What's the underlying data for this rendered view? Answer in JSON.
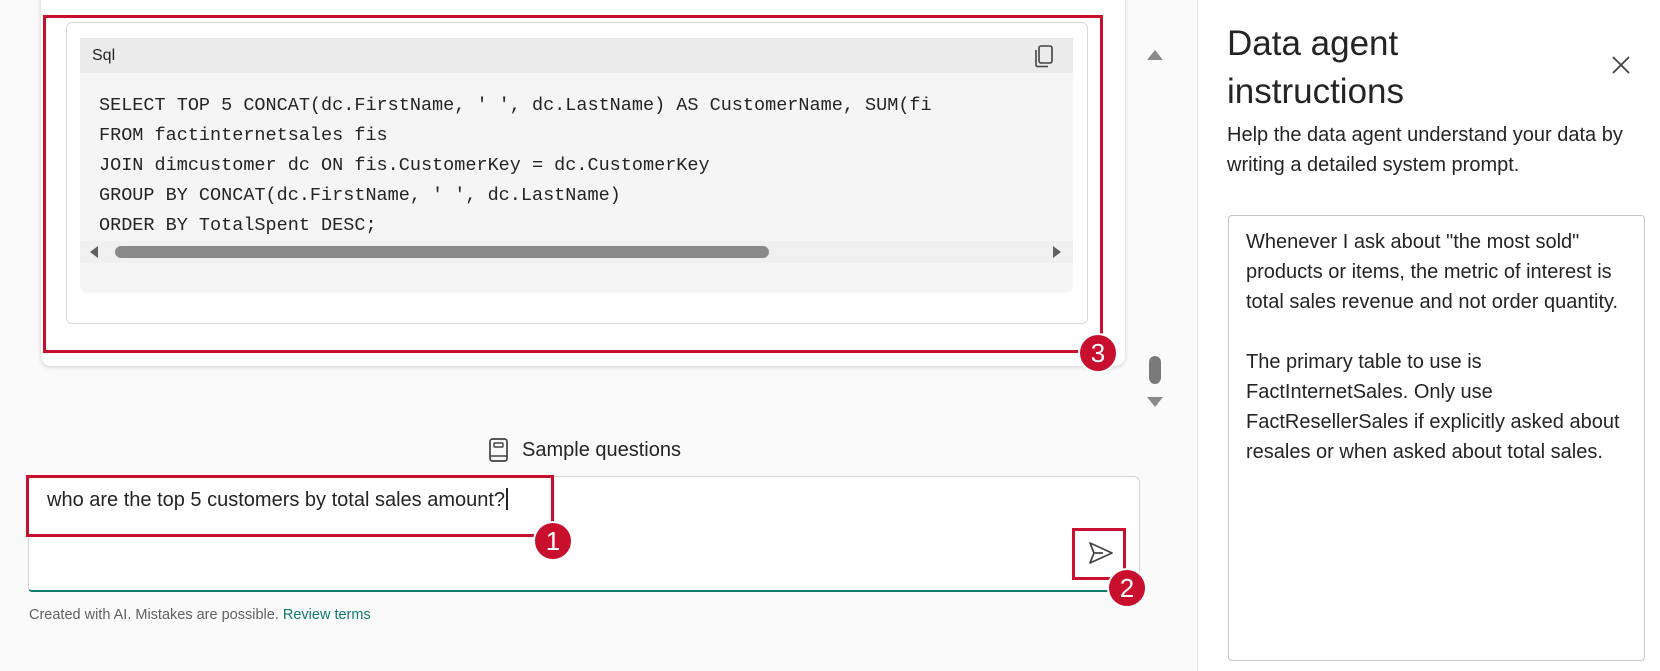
{
  "chat": {
    "code_block": {
      "language": "Sql",
      "lines": [
        "SELECT TOP 5 CONCAT(dc.FirstName, ' ', dc.LastName) AS CustomerName, SUM(fi",
        "FROM factinternetsales fis",
        "JOIN dimcustomer dc ON fis.CustomerKey = dc.CustomerKey",
        "GROUP BY CONCAT(dc.FirstName, ' ', dc.LastName)",
        "ORDER BY TotalSpent DESC;"
      ]
    },
    "sample_questions_label": "Sample questions",
    "input_text": "who are the top 5 customers by total sales amount?",
    "disclaimer_text": "Created with AI. Mistakes are possible. ",
    "review_terms_label": "Review terms"
  },
  "annotations": {
    "badge_1": "1",
    "badge_2": "2",
    "badge_3": "3",
    "color": "#c8102e"
  },
  "instructions_panel": {
    "title": "Data agent instructions",
    "description": "Help the data agent understand your data by writing a detailed system prompt.",
    "paragraph_1": "Whenever I ask about \"the most sold\" products or items, the metric of interest is total sales revenue and not order quantity.",
    "paragraph_2": "The primary table to use is FactInternetSales. Only use FactResellerSales if explicitly asked about resales or when asked about total sales."
  },
  "theme": {
    "accent": "#0f7b6c",
    "frame_border": "#3fb6c6"
  }
}
